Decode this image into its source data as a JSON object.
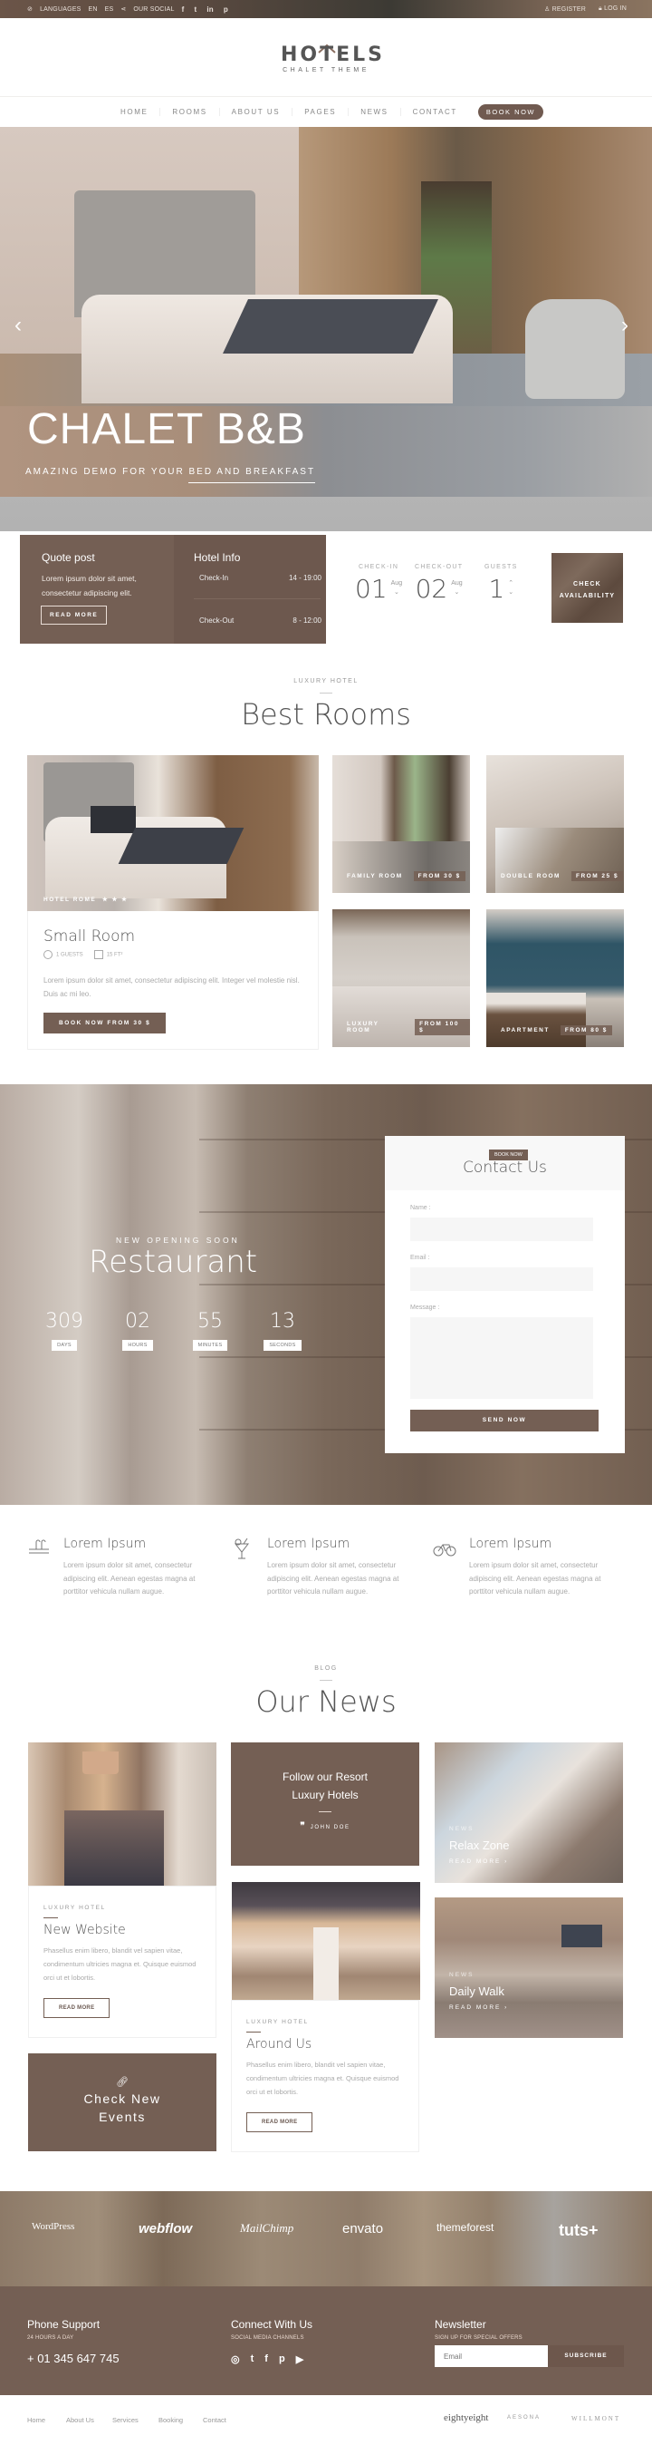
{
  "topbar": {
    "languages_label": "LANGUAGES",
    "lang_en": "EN",
    "lang_es": "ES",
    "social_label": "OUR SOCIAL",
    "social_icons": [
      "facebook-icon",
      "twitter-icon",
      "linkedin-icon",
      "pinterest-icon"
    ],
    "social_glyphs": [
      "f",
      "t",
      "in",
      "p"
    ],
    "register": "REGISTER",
    "login": "LOG IN"
  },
  "logo": {
    "title": "HOTELS",
    "subtitle": "CHALET THEME"
  },
  "nav": {
    "items": [
      "HOME",
      "ROOMS",
      "ABOUT US",
      "PAGES",
      "NEWS",
      "CONTACT"
    ],
    "book_now": "BOOK NOW"
  },
  "hero": {
    "title": "CHALET B&B",
    "subtitle": "AMAZING DEMO FOR YOUR  BED AND BREAKFAST",
    "prev": "‹",
    "next": "›"
  },
  "quote": {
    "title": "Quote post",
    "text": "Lorem ipsum dolor sit amet, consectetur adipiscing elit.",
    "button": "READ MORE"
  },
  "hotel_info": {
    "title": "Hotel Info",
    "rows": [
      {
        "label": "Check-In",
        "value": "14 - 19:00"
      },
      {
        "label": "Check-Out",
        "value": "8 - 12:00"
      }
    ]
  },
  "booking": {
    "checkin": {
      "label": "CHECK-IN",
      "day": "01",
      "month": "Aug"
    },
    "checkout": {
      "label": "CHECK-OUT",
      "day": "02",
      "month": "Aug"
    },
    "guests": {
      "label": "GUESTS",
      "value": "1"
    },
    "check_button": "CHECK AVAILABILITY"
  },
  "rooms_section": {
    "kicker": "LUXURY HOTEL",
    "title": "Best Rooms",
    "featured": {
      "caption": "HOTEL ROME",
      "stars": "★ ★ ★",
      "title": "Small Room",
      "guests": "1 GUESTS",
      "size": "15 FT²",
      "description": "Lorem ipsum dolor sit amet, consectetur adipiscing elit. Integer vel molestie nisl. Duis ac mi leo.",
      "button": "BOOK NOW FROM 30 $"
    },
    "tiles": [
      {
        "name": "FAMILY ROOM",
        "price": "FROM 30 $"
      },
      {
        "name": "DOUBLE ROOM",
        "price": "FROM 25 $"
      },
      {
        "name": "LUXURY ROOM",
        "price": "FROM 100 $"
      },
      {
        "name": "APARTMENT",
        "price": "FROM 80 $"
      }
    ]
  },
  "restaurant": {
    "kicker": "NEW OPENING SOON",
    "title": "Restaurant",
    "countdown": [
      {
        "value": "309",
        "unit": "DAYS"
      },
      {
        "value": "02",
        "unit": "HOURS"
      },
      {
        "value": "55",
        "unit": "MINUTES"
      },
      {
        "value": "13",
        "unit": "SECONDS"
      }
    ]
  },
  "contact": {
    "badge": "BOOK NOW",
    "title": "Contact Us",
    "name_label": "Name :",
    "email_label": "Email :",
    "message_label": "Message :",
    "name_value": "",
    "email_value": "",
    "message_value": "",
    "send": "SEND NOW"
  },
  "features": [
    {
      "icon": "pool-icon",
      "title": "Lorem Ipsum",
      "text": "Lorem ipsum dolor sit amet, consectetur adipiscing elit. Aenean egestas magna at porttitor vehicula nullam augue."
    },
    {
      "icon": "cocktail-icon",
      "title": "Lorem Ipsum",
      "text": "Lorem ipsum dolor sit amet, consectetur adipiscing elit. Aenean egestas magna at porttitor vehicula nullam augue."
    },
    {
      "icon": "bicycle-icon",
      "title": "Lorem Ipsum",
      "text": "Lorem ipsum dolor sit amet, consectetur adipiscing elit. Aenean egestas magna at porttitor vehicula nullam augue."
    }
  ],
  "news_section": {
    "kicker": "BLOG",
    "title": "Our News",
    "post1": {
      "kicker": "LUXURY HOTEL",
      "title": "New Website",
      "text": "Phasellus enim libero, blandit vel sapien vitae, condimentum ultricies magna et. Quisque euismod orci ut et lobortis.",
      "button": "READ MORE"
    },
    "quote": {
      "text": "Follow our Resort Luxury Hotels",
      "author": "JOHN DOE"
    },
    "post2": {
      "kicker": "LUXURY HOTEL",
      "title": "Around Us",
      "text": "Phasellus enim libero, blandit vel sapien vitae, condimentum ultricies magna et. Quisque euismod orci ut et lobortis.",
      "button": "READ MORE"
    },
    "events": "Check New Events",
    "overlay1": {
      "kicker": "NEWS",
      "title": "Relax Zone",
      "link": "READ MORE  ›"
    },
    "overlay2": {
      "kicker": "NEWS",
      "title": "Daily Walk",
      "link": "READ MORE  ›"
    }
  },
  "partners": [
    "WordPress",
    "webflow",
    "MailChimp",
    "envato",
    "themeforest",
    "tuts+"
  ],
  "footer": {
    "phone": {
      "title": "Phone Support",
      "sub": "24 HOURS A DAY",
      "value": "+ 01 345 647 745"
    },
    "connect": {
      "title": "Connect With Us",
      "sub": "SOCIAL MEDIA CHANNELS"
    },
    "newsletter": {
      "title": "Newsletter",
      "sub": "SIGN UP FOR SPECIAL OFFERS",
      "placeholder": "Email",
      "button": "SUBSCRIBE"
    },
    "links": [
      "Home",
      "About Us",
      "Services",
      "Booking",
      "Contact"
    ],
    "brands": [
      "eightyeight",
      "AESONA",
      "WILLMONT"
    ]
  },
  "colors": {
    "accent": "#745f54",
    "text": "#555555",
    "muted": "#aaaaaa"
  }
}
